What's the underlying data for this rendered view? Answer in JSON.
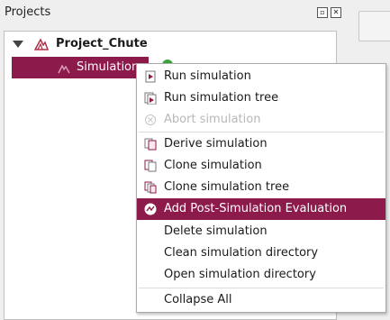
{
  "panel": {
    "title": "Projects"
  },
  "tree": {
    "project_label": "Project_Chute",
    "simulation_label": "Simulation"
  },
  "context_menu": {
    "items": [
      {
        "label": "Run simulation",
        "icon": "run-icon",
        "enabled": true
      },
      {
        "label": "Run simulation tree",
        "icon": "run-tree-icon",
        "enabled": true
      },
      {
        "label": "Abort simulation",
        "icon": "abort-icon",
        "enabled": false
      },
      {
        "label": "Derive simulation",
        "icon": "derive-icon",
        "enabled": true
      },
      {
        "label": "Clone simulation",
        "icon": "clone-icon",
        "enabled": true
      },
      {
        "label": "Clone simulation tree",
        "icon": "clone-tree-icon",
        "enabled": true
      },
      {
        "label": "Add Post-Simulation Evaluation",
        "icon": "evaluation-icon",
        "enabled": true,
        "highlighted": true
      },
      {
        "label": "Delete simulation",
        "enabled": true
      },
      {
        "label": "Clean simulation directory",
        "enabled": true
      },
      {
        "label": "Open simulation directory",
        "enabled": true
      },
      {
        "label": "Collapse All",
        "enabled": true
      }
    ]
  },
  "colors": {
    "selection": "#8c1a4b",
    "status_ok": "#3aa33a"
  }
}
